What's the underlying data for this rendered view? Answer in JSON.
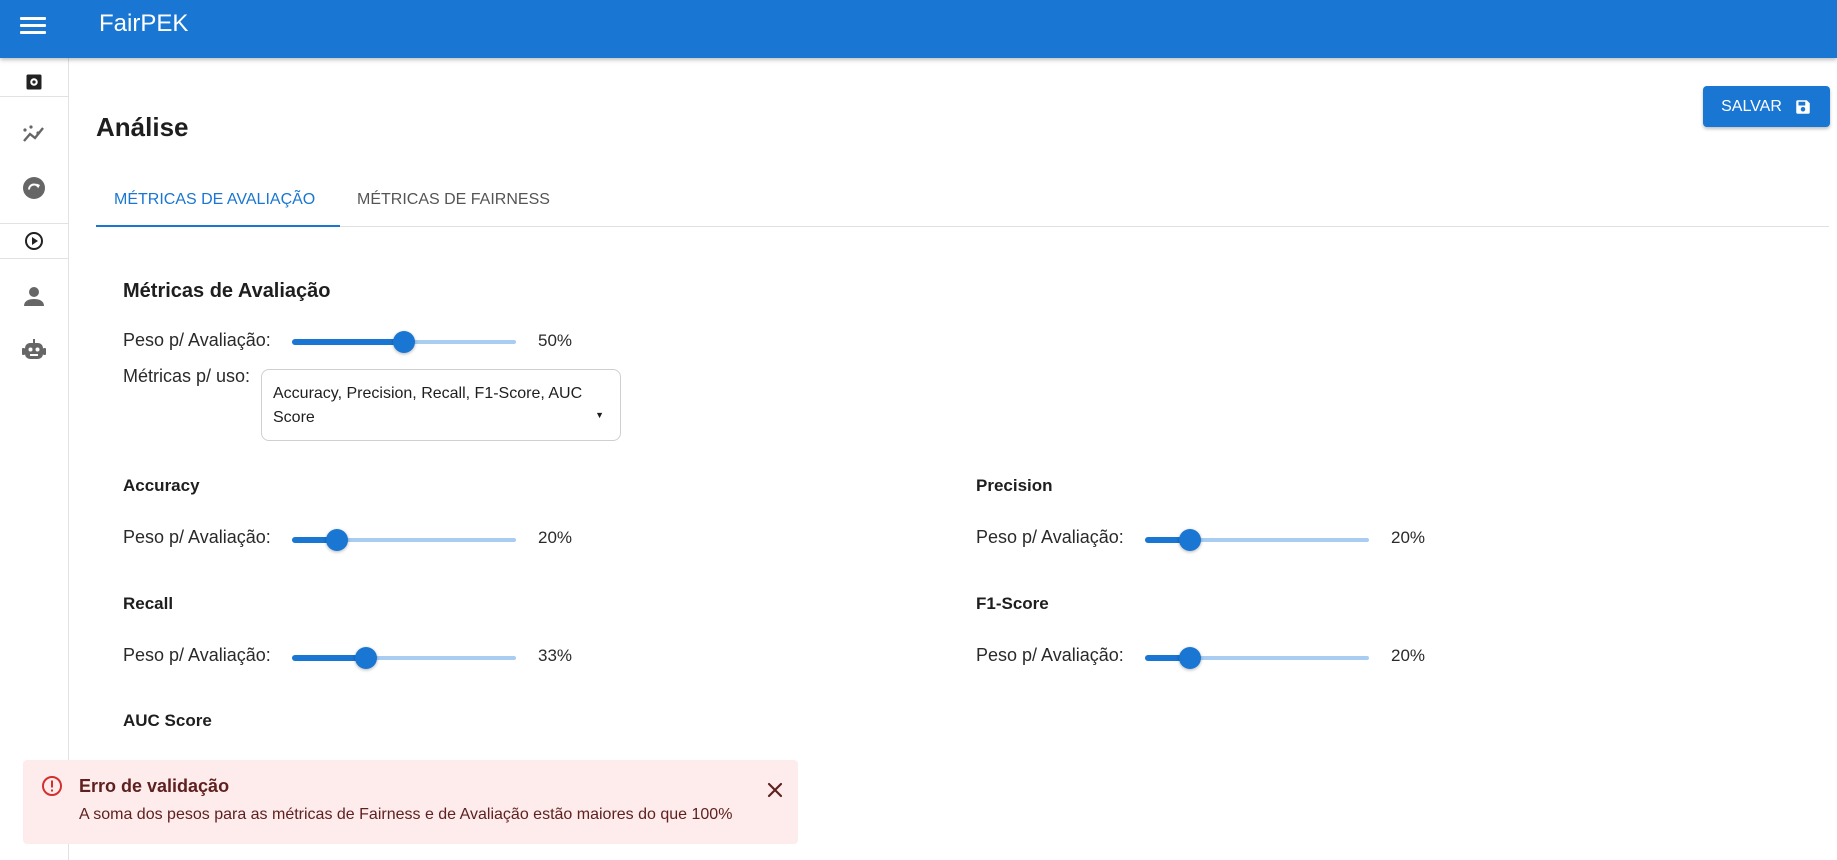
{
  "app": {
    "title": "FairPEK",
    "accent": "#1976d2"
  },
  "header": {
    "title": "Análise",
    "save_label": "SALVAR"
  },
  "sidebar": {
    "items": [
      {
        "icon": "settings-box-icon"
      },
      {
        "icon": "trend-chart-icon"
      },
      {
        "icon": "refresh-circle-icon"
      },
      {
        "icon": "play-circle-icon"
      },
      {
        "icon": "person-icon"
      },
      {
        "icon": "robot-icon"
      }
    ]
  },
  "tabs": [
    {
      "label": "MÉTRICAS DE AVALIAÇÃO",
      "active": true
    },
    {
      "label": "MÉTRICAS DE FAIRNESS",
      "active": false
    }
  ],
  "section": {
    "title": "Métricas de Avaliação",
    "weight_label": "Peso p/ Avaliação:",
    "weight_value": "50%",
    "weight_fraction": 0.5,
    "metrics_label": "Métricas p/ uso:",
    "metrics_selected": "Accuracy, Precision, Recall, F1-Score, AUC Score"
  },
  "metrics": [
    {
      "name": "Accuracy",
      "label": "Peso p/ Avaliação:",
      "value": "20%",
      "fraction": 0.2
    },
    {
      "name": "Precision",
      "label": "Peso p/ Avaliação:",
      "value": "20%",
      "fraction": 0.2
    },
    {
      "name": "Recall",
      "label": "Peso p/ Avaliação:",
      "value": "33%",
      "fraction": 0.33
    },
    {
      "name": "F1-Score",
      "label": "Peso p/ Avaliação:",
      "value": "20%",
      "fraction": 0.2
    },
    {
      "name": "AUC Score"
    }
  ],
  "alert": {
    "title": "Erro de validação",
    "message": "A soma dos pesos para as métricas de Fairness e de Avaliação estão maiores do que 100%",
    "background": "#fdeceb",
    "color": "#d32f2f"
  }
}
